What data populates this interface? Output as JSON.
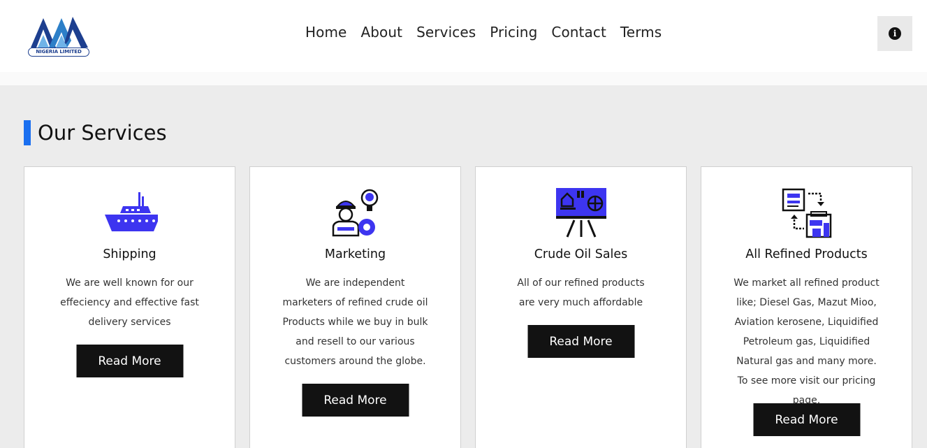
{
  "header": {
    "logo": {
      "icon": "company-logo",
      "text": "NIGERIA LIMITED"
    },
    "nav": [
      {
        "label": "Home"
      },
      {
        "label": "About"
      },
      {
        "label": "Services"
      },
      {
        "label": "Pricing"
      },
      {
        "label": "Contact"
      },
      {
        "label": "Terms"
      }
    ],
    "info_icon": "info-circle-icon"
  },
  "section": {
    "title": "Our Services",
    "accent_color": "#1a6ff0"
  },
  "cards": [
    {
      "icon": "ship-icon",
      "title": "Shipping",
      "text": "We are well known for our effeciency and effective fast delivery services",
      "button": "Read More"
    },
    {
      "icon": "worker-idea-icon",
      "title": "Marketing",
      "text": "We are independent marketers of refined crude oil Products while we buy in bulk and resell to our various customers around the globe.",
      "button": "Read More"
    },
    {
      "icon": "presentation-board-icon",
      "title": "Crude Oil Sales",
      "text": "All of our refined products are very much affordable",
      "button": "Read More"
    },
    {
      "icon": "refined-products-icon",
      "title": "All Refined Products",
      "text": "We market all refined product like; Diesel Gas, Mazut Mioo, Aviation kerosene, Liquidified Petroleum gas, Liquidified Natural gas and many more. To see more visit our pricing page.",
      "button": "Read More"
    }
  ],
  "colors": {
    "icon_accent": "#3d35f0",
    "button_bg": "#121212",
    "page_bg": "#ececec"
  }
}
